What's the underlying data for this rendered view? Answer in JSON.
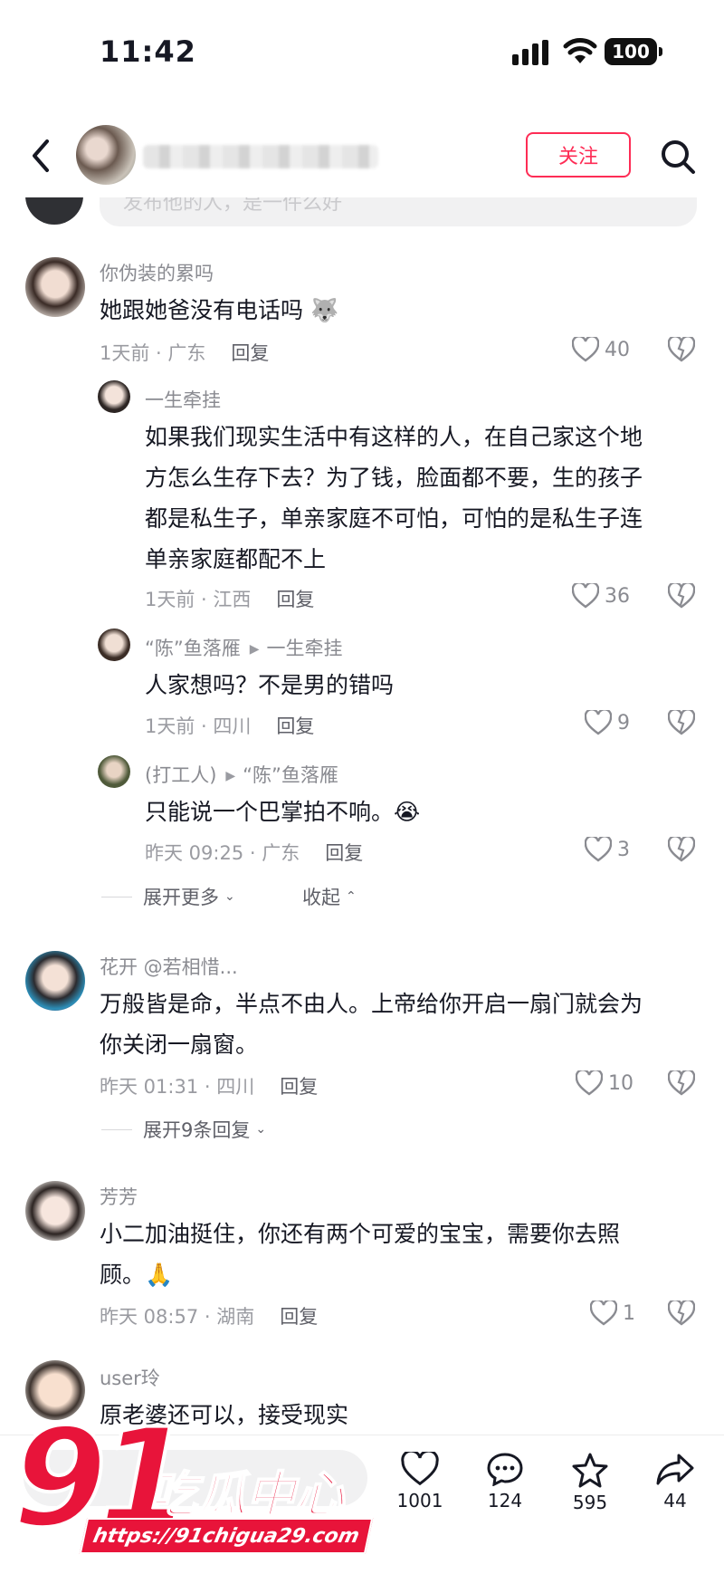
{
  "status_bar": {
    "time": "11:42",
    "battery": "100"
  },
  "header": {
    "follow_label": "关注"
  },
  "input_strip": {
    "placeholder_partial": "发布他的人，是一件么好"
  },
  "colors": {
    "accent": "#fe2c55",
    "text": "#161823",
    "muted": "#8a8b91"
  },
  "comments": [
    {
      "user": "你伪装的累吗",
      "text": "她跟她爸没有电话吗 🐺",
      "time_location": "1天前 · 广东",
      "reply_label": "回复",
      "likes": "40",
      "replies": [
        {
          "user": "一生牵挂",
          "text_lines": [
            "如果我们现实生活中有这样的人，在自己家这个地",
            "方怎么生存下去？为了钱，脸面都不要，生的孩子",
            "都是私生子，单亲家庭不可怕，可怕的是私生子连",
            "单亲家庭都配不上"
          ],
          "time_location": "1天前 · 江西",
          "reply_label": "回复",
          "likes": "36"
        },
        {
          "user": "“陈”鱼落雁",
          "reply_to": "一生牵挂",
          "text": "人家想吗？不是男的错吗",
          "time_location": "1天前 · 四川",
          "reply_label": "回复",
          "likes": "9"
        },
        {
          "user": "(打工人)",
          "reply_to": "“陈”鱼落雁",
          "text": "只能说一个巴掌拍不响。😭",
          "time_location": "昨天 09:25 · 广东",
          "reply_label": "回复",
          "likes": "3"
        }
      ],
      "expand_more": "展开更多",
      "collapse": "收起"
    },
    {
      "user": "花开 @若相惜...",
      "text_lines": [
        "万般皆是命，半点不由人。上帝给你开启一扇门就会为",
        "你关闭一扇窗。"
      ],
      "time_location": "昨天 01:31 · 四川",
      "reply_label": "回复",
      "likes": "10",
      "expand_replies": "展开9条回复"
    },
    {
      "user": "芳芳",
      "text_lines": [
        "小二加油挺住，你还有两个可爱的宝宝，需要你去照",
        "顾。🙏"
      ],
      "time_location": "昨天 08:57 · 湖南",
      "reply_label": "回复",
      "likes": "1"
    },
    {
      "user": "user玲",
      "text": "原老婆还可以，接受现实"
    }
  ],
  "bottom_bar": {
    "likes": "1001",
    "comments": "124",
    "favorites": "595",
    "shares": "44"
  },
  "watermark": {
    "big": "91",
    "brand": "吃瓜中心",
    "url": "https://91chigua29.com"
  }
}
